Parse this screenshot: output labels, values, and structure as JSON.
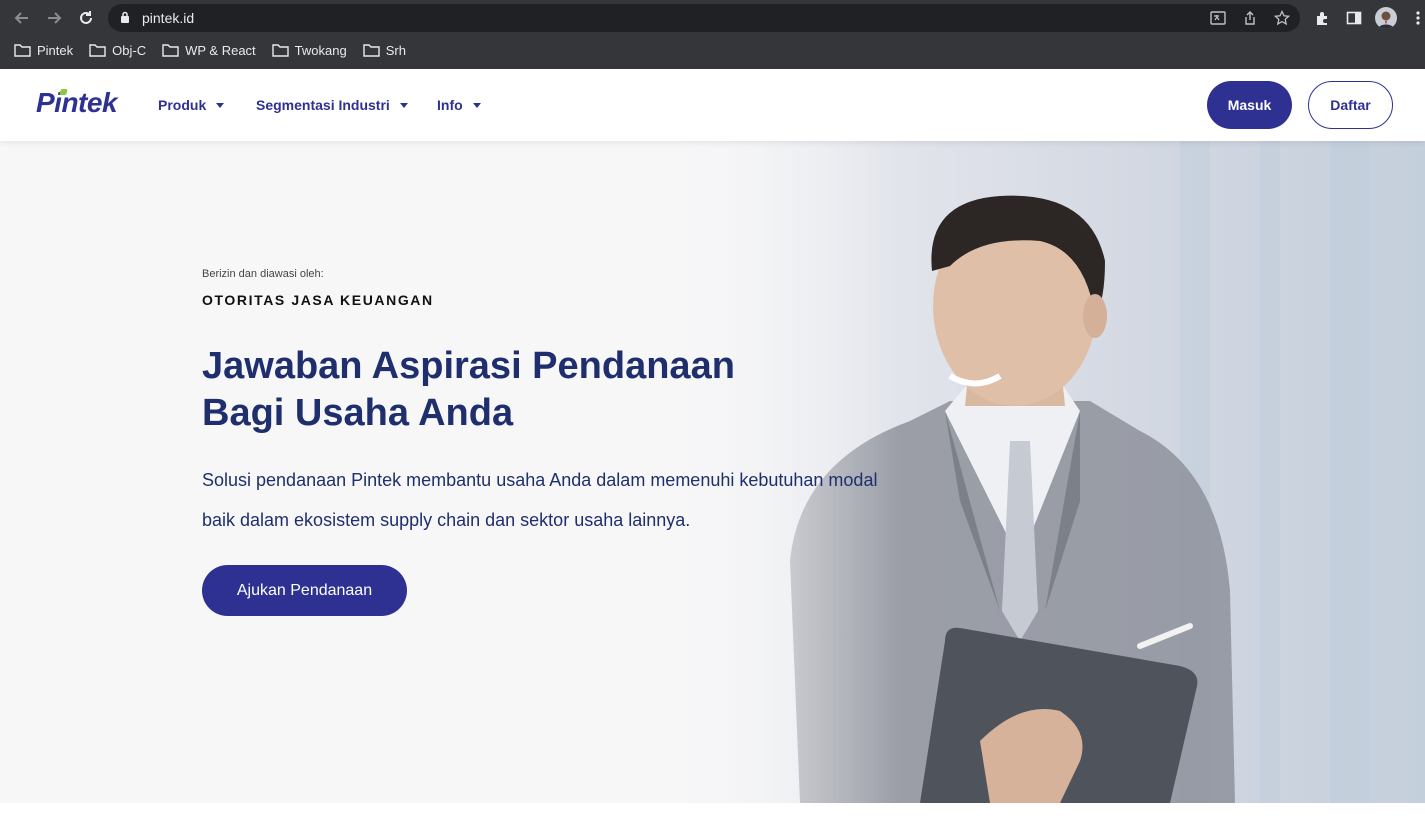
{
  "browser": {
    "url": "pintek.id",
    "bookmarks": [
      "Pintek",
      "Obj-C",
      "WP & React",
      "Twokang",
      "Srh"
    ]
  },
  "header": {
    "logo": "Pintek",
    "menu": [
      "Produk",
      "Segmentasi Industri",
      "Info"
    ],
    "login_label": "Masuk",
    "register_label": "Daftar"
  },
  "hero": {
    "kicker": "Berizin dan diawasi oleh:",
    "regulator": "OTORITAS JASA KEUANGAN",
    "headline_line1": "Jawaban Aspirasi Pendanaan",
    "headline_line2": "Bagi Usaha Anda",
    "subtext_line1": "Solusi pendanaan Pintek membantu usaha Anda dalam memenuhi kebutuhan modal",
    "subtext_line2": "baik dalam ekosistem supply chain dan sektor usaha lainnya.",
    "cta_label": "Ajukan Pendanaan"
  },
  "colors": {
    "brand": "#2e3192",
    "brand_accent": "#8dc63f",
    "headline": "#1f2f6e",
    "chrome": "#35363a"
  },
  "icons": [
    "back-icon",
    "forward-icon",
    "reload-icon",
    "lock-icon",
    "translate-icon",
    "share-icon",
    "star-icon",
    "extensions-icon",
    "sidepanel-icon",
    "profile-avatar",
    "more-icon",
    "folder-icon",
    "caret-down-icon"
  ]
}
